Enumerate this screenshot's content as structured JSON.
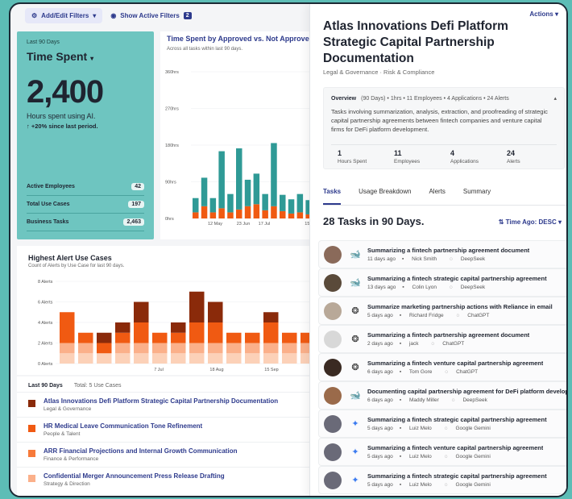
{
  "topbar": {
    "filters_label": "Add/Edit Filters",
    "show_active_label": "Show Active Filters",
    "active_count": "2"
  },
  "kpi": {
    "period": "Last 90 Days",
    "title": "Time Spent",
    "value": "2,400",
    "caption": "Hours spent using AI.",
    "change": "+20% since last period.",
    "rows": [
      {
        "label": "Active Employees",
        "value": "42"
      },
      {
        "label": "Total Use Cases",
        "value": "197"
      },
      {
        "label": "Business Tasks",
        "value": "2,463"
      }
    ]
  },
  "time_chart": {
    "title": "Time Spent by Approved vs. Not Approved",
    "subtitle": "Across all tasks within last 90 days."
  },
  "alert_chart": {
    "title": "Highest Alert Use Cases",
    "subtitle": "Count of Alerts by Use Case for last 90 days."
  },
  "colors": {
    "teal": "#2f9a96",
    "orange": "#f05a12",
    "dark_red": "#8a2a0a",
    "mid_orange": "#f77a3a",
    "light_orange": "#fbb08a",
    "pale_orange": "#fcd1b8",
    "accent": "#2d3a8c"
  },
  "chart_data": [
    {
      "type": "bar",
      "title": "Time Spent by Approved vs. Not Approved",
      "ylim": [
        0,
        360
      ],
      "yticks": [
        "0hrs",
        "90hrs",
        "180hrs",
        "270hrs",
        "360hrs"
      ],
      "xticks": [
        "12 May",
        "23 Jun",
        "17 Jul",
        "15 Sep"
      ],
      "series": [
        {
          "values": [
            35,
            70,
            35,
            140,
            45,
            150,
            65,
            75,
            40,
            155,
            40,
            35,
            45,
            35
          ]
        },
        {
          "values": [
            15,
            30,
            15,
            25,
            15,
            22,
            30,
            35,
            20,
            30,
            18,
            12,
            15,
            10
          ]
        }
      ]
    },
    {
      "type": "bar",
      "title": "Highest Alert Use Cases",
      "ylim": [
        0,
        8
      ],
      "yticks": [
        "0 Alerts",
        "2 Alerts",
        "4 Alerts",
        "6 Alerts",
        "8 Alerts"
      ],
      "xticks": [
        "7 Jul",
        "18 Aug",
        "15 Sep"
      ],
      "series": [
        {
          "values": [
            1,
            1,
            1,
            1,
            1,
            1,
            1,
            1,
            1,
            1,
            1,
            1,
            1,
            1
          ]
        },
        {
          "values": [
            1,
            1,
            0,
            1,
            1,
            1,
            1,
            1,
            1,
            1,
            1,
            1,
            1,
            1
          ]
        },
        {
          "values": [
            3,
            1,
            1,
            1,
            2,
            1,
            1,
            2,
            2,
            1,
            1,
            2,
            1,
            1
          ]
        },
        {
          "values": [
            0,
            0,
            1,
            1,
            2,
            0,
            1,
            3,
            2,
            0,
            0,
            1,
            0,
            0
          ]
        }
      ]
    }
  ],
  "use_cases": {
    "period": "Last 90 Days",
    "total": "Total: 5 Use Cases",
    "items": [
      {
        "name": "Atlas Innovations Defi Platform Strategic Capital Partnership Documentation",
        "category": "Legal & Governance",
        "color": "#8a2a0a"
      },
      {
        "name": "HR Medical Leave Communication Tone Refinement",
        "category": "People & Talent",
        "color": "#f05a12"
      },
      {
        "name": "ARR Financial Projections and Internal Growth Communication",
        "category": "Finance & Performance",
        "color": "#f77a3a"
      },
      {
        "name": "Confidential Merger Announcement Press Release Drafting",
        "category": "Strategy & Direction",
        "color": "#fbb08a"
      }
    ]
  },
  "detail": {
    "actions_label": "Actions",
    "title": "Atlas Innovations Defi Platform Strategic Capital Partnership Documentation",
    "subtitle": "Legal & Governance · Risk & Compliance",
    "overview_label": "Overview",
    "overview_meta": "(90 Days) • 1hrs • 11 Employees • 4 Applications • 24 Alerts",
    "overview_text": "Tasks involving summarization, analysis, extraction, and proofreading of strategic capital partnership agreements between fintech companies and venture capital firms for DeFi platform development.",
    "stats": [
      {
        "value": "1",
        "label": "Hours Spent"
      },
      {
        "value": "11",
        "label": "Employees"
      },
      {
        "value": "4",
        "label": "Applications"
      },
      {
        "value": "24",
        "label": "Alerts"
      }
    ],
    "tabs": [
      "Tasks",
      "Usage Breakdown",
      "Alerts",
      "Summary"
    ],
    "tasks_heading": "28 Tasks in 90 Days.",
    "sort_label": "Time Ago: DESC",
    "tasks": [
      {
        "name": "Summarizing a fintech partnership agreement document",
        "ago": "11 days ago",
        "user": "Nick Smith",
        "app": "DeepSeek",
        "icon": "deepseek-icon",
        "avatar": "#8a6a5a"
      },
      {
        "name": "Summarizing a fintech strategic capital partnership agreement",
        "ago": "13 days ago",
        "user": "Colin Lyon",
        "app": "DeepSeek",
        "icon": "deepseek-icon",
        "avatar": "#5a4a3a"
      },
      {
        "name": "Summarize marketing partnership actions with Reliance in email",
        "ago": "5 days ago",
        "user": "Richard Fridge",
        "app": "ChatGPT",
        "icon": "chatgpt-icon",
        "avatar": "#b8a898"
      },
      {
        "name": "Summarizing a fintech partnership agreement document",
        "ago": "2 days ago",
        "user": "jack",
        "app": "ChatGPT",
        "icon": "chatgpt-icon",
        "avatar": "#d8d8d8"
      },
      {
        "name": "Summarizing a fintech venture capital partnership agreement",
        "ago": "6 days ago",
        "user": "Tom Gore",
        "app": "ChatGPT",
        "icon": "chatgpt-icon",
        "avatar": "#3a2a22"
      },
      {
        "name": "Documenting capital partnership agreement for DeFi platform development",
        "ago": "6 days ago",
        "user": "Maddy Miller",
        "app": "DeepSeek",
        "icon": "deepseek-icon",
        "avatar": "#9a6a4a"
      },
      {
        "name": "Summarizing a fintech strategic capital partnership agreement",
        "ago": "5 days ago",
        "user": "Luiz Melo",
        "app": "Google Gemini",
        "icon": "gemini-icon",
        "avatar": "#6a6a78"
      },
      {
        "name": "Summarizing a fintech venture capital partnership agreement",
        "ago": "5 days ago",
        "user": "Luiz Melo",
        "app": "Google Gemini",
        "icon": "gemini-icon",
        "avatar": "#6a6a78"
      },
      {
        "name": "Summarizing a fintech strategic capital partnership agreement",
        "ago": "5 days ago",
        "user": "Luiz Melo",
        "app": "Google Gemini",
        "icon": "gemini-icon",
        "avatar": "#6a6a78"
      }
    ]
  }
}
